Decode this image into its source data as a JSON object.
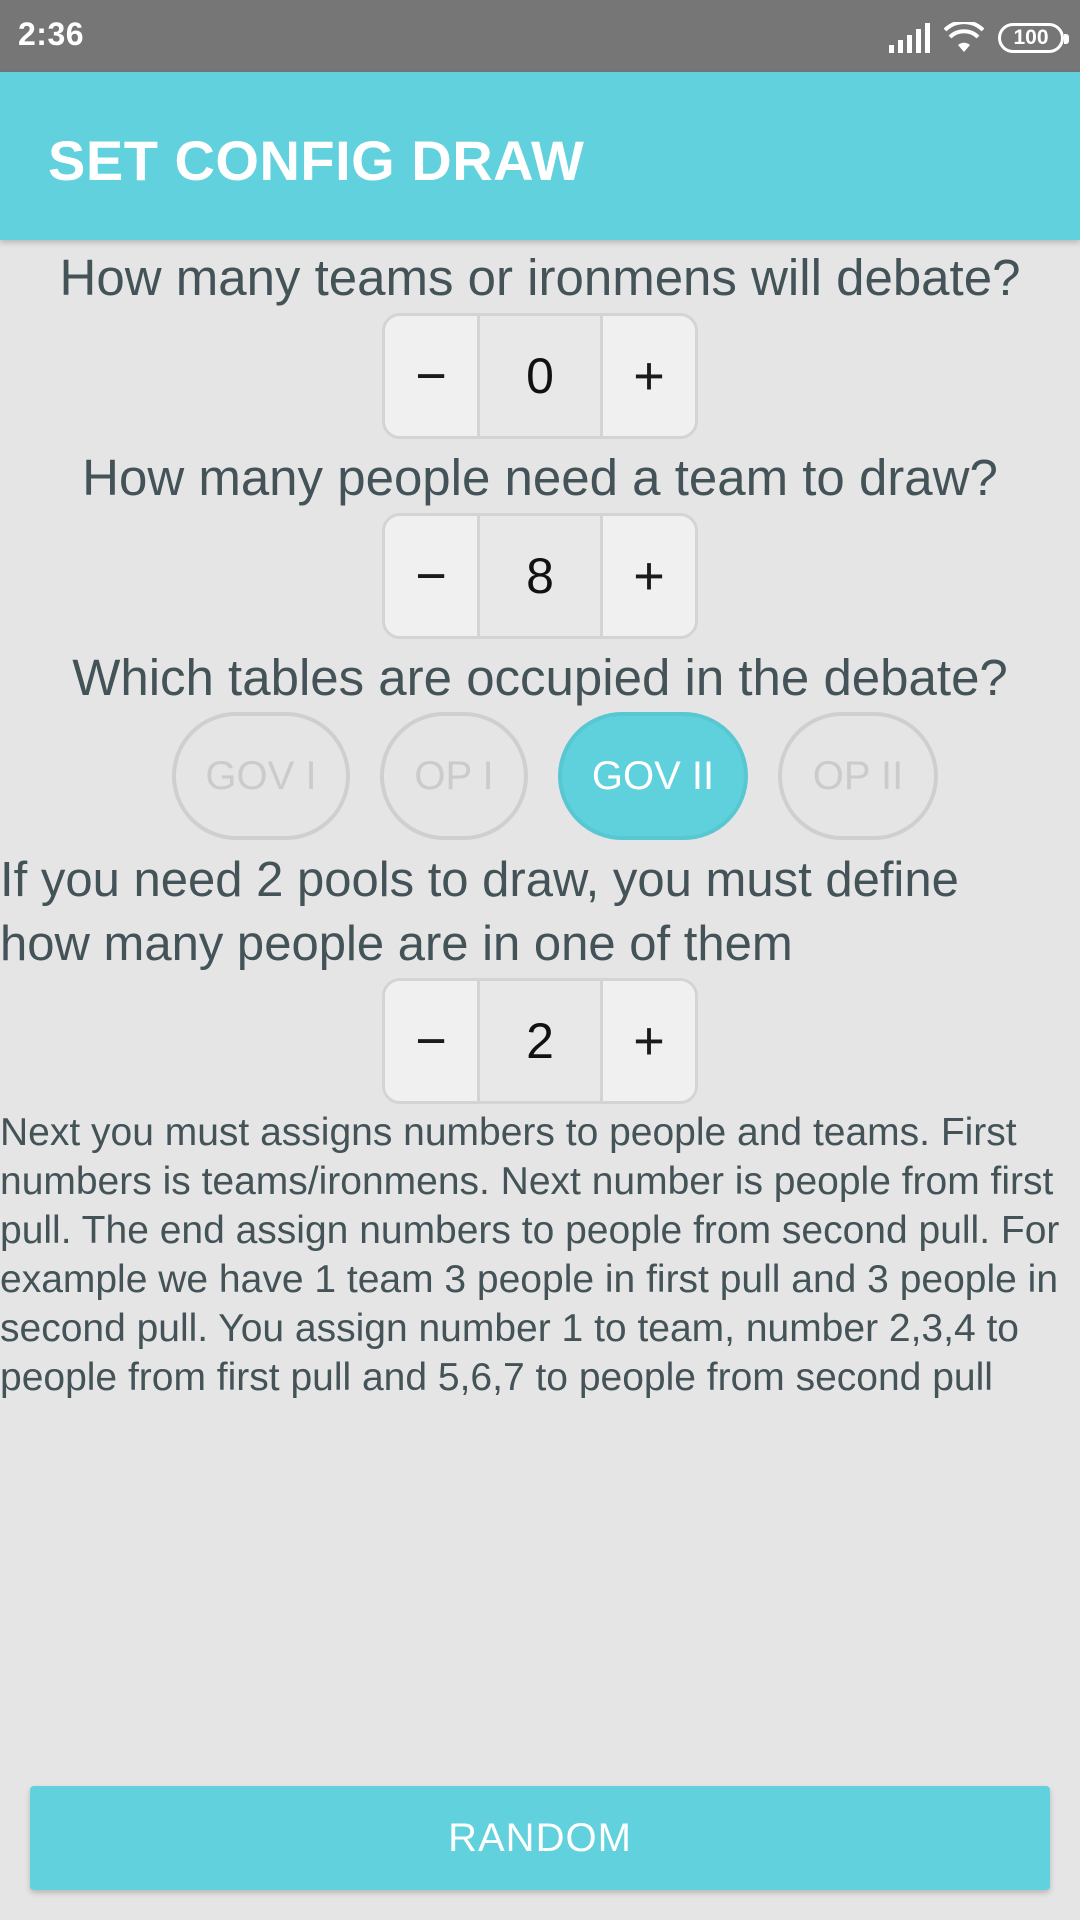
{
  "status_bar": {
    "time": "2:36",
    "battery": "100",
    "icons": [
      "signal-icon",
      "wifi-icon",
      "battery-icon"
    ]
  },
  "app_bar": {
    "title": "SET CONFIG DRAW",
    "color": "#60d1dd"
  },
  "teams_question": {
    "text": "How many teams or ironmens will debate?",
    "minus": "−",
    "value": "0",
    "plus": "+"
  },
  "people_question": {
    "text": "How many people need a team to draw?",
    "minus": "−",
    "value": "8",
    "plus": "+"
  },
  "tables_question": {
    "text": "Which tables are occupied in the debate?",
    "options": [
      {
        "label": "GOV I",
        "selected": false
      },
      {
        "label": "OP I",
        "selected": false
      },
      {
        "label": "GOV II",
        "selected": true
      },
      {
        "label": "OP II",
        "selected": false
      }
    ]
  },
  "pools_question": {
    "line1": "If you need 2 pools to draw, you must define",
    "line2": "how many people are in one of them",
    "minus": "−",
    "value": "2",
    "plus": "+"
  },
  "info_text": "Next you must assigns numbers to people and teams. First numbers is teams/ironmens. Next number is people from first pull. The end assign numbers to people from second pull. For example we have 1 team 3 people in first pull and 3 people in second pull. You assign number 1 to team, number 2,3,4 to people from first pull and 5,6,7 to people from second pull",
  "random_button": "RANDOM"
}
